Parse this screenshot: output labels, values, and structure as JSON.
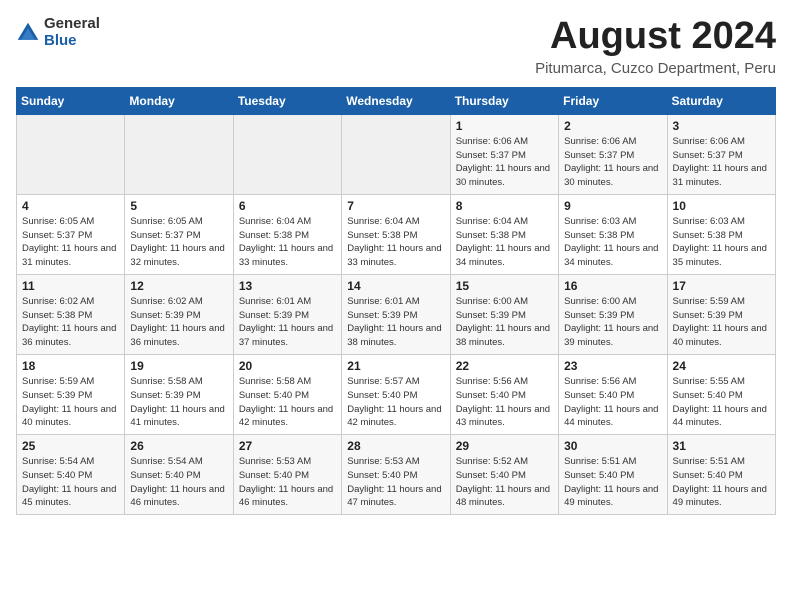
{
  "header": {
    "logo_general": "General",
    "logo_blue": "Blue",
    "month_title": "August 2024",
    "location": "Pitumarca, Cuzco Department, Peru"
  },
  "weekdays": [
    "Sunday",
    "Monday",
    "Tuesday",
    "Wednesday",
    "Thursday",
    "Friday",
    "Saturday"
  ],
  "weeks": [
    [
      {
        "day": "",
        "info": ""
      },
      {
        "day": "",
        "info": ""
      },
      {
        "day": "",
        "info": ""
      },
      {
        "day": "",
        "info": ""
      },
      {
        "day": "1",
        "info": "Sunrise: 6:06 AM\nSunset: 5:37 PM\nDaylight: 11 hours and 30 minutes."
      },
      {
        "day": "2",
        "info": "Sunrise: 6:06 AM\nSunset: 5:37 PM\nDaylight: 11 hours and 30 minutes."
      },
      {
        "day": "3",
        "info": "Sunrise: 6:06 AM\nSunset: 5:37 PM\nDaylight: 11 hours and 31 minutes."
      }
    ],
    [
      {
        "day": "4",
        "info": "Sunrise: 6:05 AM\nSunset: 5:37 PM\nDaylight: 11 hours and 31 minutes."
      },
      {
        "day": "5",
        "info": "Sunrise: 6:05 AM\nSunset: 5:37 PM\nDaylight: 11 hours and 32 minutes."
      },
      {
        "day": "6",
        "info": "Sunrise: 6:04 AM\nSunset: 5:38 PM\nDaylight: 11 hours and 33 minutes."
      },
      {
        "day": "7",
        "info": "Sunrise: 6:04 AM\nSunset: 5:38 PM\nDaylight: 11 hours and 33 minutes."
      },
      {
        "day": "8",
        "info": "Sunrise: 6:04 AM\nSunset: 5:38 PM\nDaylight: 11 hours and 34 minutes."
      },
      {
        "day": "9",
        "info": "Sunrise: 6:03 AM\nSunset: 5:38 PM\nDaylight: 11 hours and 34 minutes."
      },
      {
        "day": "10",
        "info": "Sunrise: 6:03 AM\nSunset: 5:38 PM\nDaylight: 11 hours and 35 minutes."
      }
    ],
    [
      {
        "day": "11",
        "info": "Sunrise: 6:02 AM\nSunset: 5:38 PM\nDaylight: 11 hours and 36 minutes."
      },
      {
        "day": "12",
        "info": "Sunrise: 6:02 AM\nSunset: 5:39 PM\nDaylight: 11 hours and 36 minutes."
      },
      {
        "day": "13",
        "info": "Sunrise: 6:01 AM\nSunset: 5:39 PM\nDaylight: 11 hours and 37 minutes."
      },
      {
        "day": "14",
        "info": "Sunrise: 6:01 AM\nSunset: 5:39 PM\nDaylight: 11 hours and 38 minutes."
      },
      {
        "day": "15",
        "info": "Sunrise: 6:00 AM\nSunset: 5:39 PM\nDaylight: 11 hours and 38 minutes."
      },
      {
        "day": "16",
        "info": "Sunrise: 6:00 AM\nSunset: 5:39 PM\nDaylight: 11 hours and 39 minutes."
      },
      {
        "day": "17",
        "info": "Sunrise: 5:59 AM\nSunset: 5:39 PM\nDaylight: 11 hours and 40 minutes."
      }
    ],
    [
      {
        "day": "18",
        "info": "Sunrise: 5:59 AM\nSunset: 5:39 PM\nDaylight: 11 hours and 40 minutes."
      },
      {
        "day": "19",
        "info": "Sunrise: 5:58 AM\nSunset: 5:39 PM\nDaylight: 11 hours and 41 minutes."
      },
      {
        "day": "20",
        "info": "Sunrise: 5:58 AM\nSunset: 5:40 PM\nDaylight: 11 hours and 42 minutes."
      },
      {
        "day": "21",
        "info": "Sunrise: 5:57 AM\nSunset: 5:40 PM\nDaylight: 11 hours and 42 minutes."
      },
      {
        "day": "22",
        "info": "Sunrise: 5:56 AM\nSunset: 5:40 PM\nDaylight: 11 hours and 43 minutes."
      },
      {
        "day": "23",
        "info": "Sunrise: 5:56 AM\nSunset: 5:40 PM\nDaylight: 11 hours and 44 minutes."
      },
      {
        "day": "24",
        "info": "Sunrise: 5:55 AM\nSunset: 5:40 PM\nDaylight: 11 hours and 44 minutes."
      }
    ],
    [
      {
        "day": "25",
        "info": "Sunrise: 5:54 AM\nSunset: 5:40 PM\nDaylight: 11 hours and 45 minutes."
      },
      {
        "day": "26",
        "info": "Sunrise: 5:54 AM\nSunset: 5:40 PM\nDaylight: 11 hours and 46 minutes."
      },
      {
        "day": "27",
        "info": "Sunrise: 5:53 AM\nSunset: 5:40 PM\nDaylight: 11 hours and 46 minutes."
      },
      {
        "day": "28",
        "info": "Sunrise: 5:53 AM\nSunset: 5:40 PM\nDaylight: 11 hours and 47 minutes."
      },
      {
        "day": "29",
        "info": "Sunrise: 5:52 AM\nSunset: 5:40 PM\nDaylight: 11 hours and 48 minutes."
      },
      {
        "day": "30",
        "info": "Sunrise: 5:51 AM\nSunset: 5:40 PM\nDaylight: 11 hours and 49 minutes."
      },
      {
        "day": "31",
        "info": "Sunrise: 5:51 AM\nSunset: 5:40 PM\nDaylight: 11 hours and 49 minutes."
      }
    ]
  ]
}
